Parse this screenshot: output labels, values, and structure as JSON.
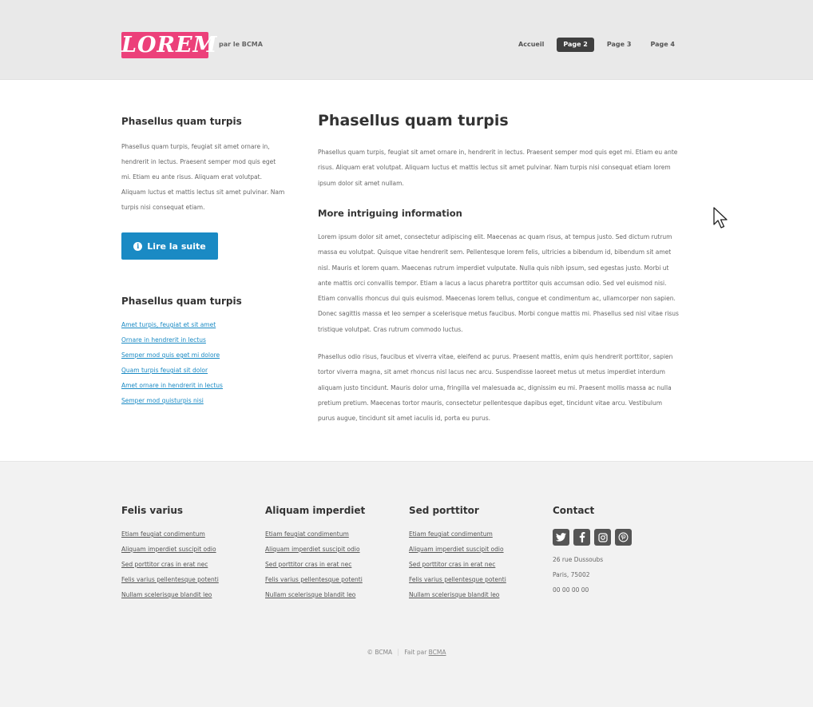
{
  "header": {
    "logo": "LOREM",
    "tagline": "par le BCMA",
    "nav": [
      "Accueil",
      "Page 2",
      "Page 3",
      "Page 4"
    ]
  },
  "sidebar": {
    "title1": "Phasellus quam turpis",
    "text": "Phasellus quam turpis, feugiat sit amet ornare in, hendrerit in lectus. Praesent semper mod quis eget mi. Etiam eu ante risus. Aliquam erat volutpat. Aliquam luctus et mattis lectus sit amet pulvinar. Nam turpis nisi consequat etiam.",
    "button_label": "Lire la suite",
    "title2": "Phasellus quam turpis",
    "links": [
      "Amet turpis, feugiat et sit amet",
      "Ornare in hendrerit in lectus",
      "Semper mod quis eget mi dolore",
      "Quam turpis feugiat sit dolor",
      "Amet ornare in hendrerit in lectus",
      "Semper mod quisturpis nisi"
    ]
  },
  "content": {
    "title": "Phasellus quam turpis",
    "intro": "Phasellus quam turpis, feugiat sit amet ornare in, hendrerit in lectus. Praesent semper mod quis eget mi. Etiam eu ante risus. Aliquam erat volutpat. Aliquam luctus et mattis lectus sit amet pulvinar. Nam turpis nisi consequat etiam lorem ipsum dolor sit amet nullam.",
    "subtitle": "More intriguing information",
    "para1": "Lorem ipsum dolor sit amet, consectetur adipiscing elit. Maecenas ac quam risus, at tempus justo. Sed dictum rutrum massa eu volutpat. Quisque vitae hendrerit sem. Pellentesque lorem felis, ultricies a bibendum id, bibendum sit amet nisl. Mauris et lorem quam. Maecenas rutrum imperdiet vulputate. Nulla quis nibh ipsum, sed egestas justo. Morbi ut ante mattis orci convallis tempor. Etiam a lacus a lacus pharetra porttitor quis accumsan odio. Sed vel euismod nisi. Etiam convallis rhoncus dui quis euismod. Maecenas lorem tellus, congue et condimentum ac, ullamcorper non sapien. Donec sagittis massa et leo semper a scelerisque metus faucibus. Morbi congue mattis mi. Phasellus sed nisl vitae risus tristique volutpat. Cras rutrum commodo luctus.",
    "para2": "Phasellus odio risus, faucibus et viverra vitae, eleifend ac purus. Praesent mattis, enim quis hendrerit porttitor, sapien tortor viverra magna, sit amet rhoncus nisl lacus nec arcu. Suspendisse laoreet metus ut metus imperdiet interdum aliquam justo tincidunt. Mauris dolor urna, fringilla vel malesuada ac, dignissim eu mi. Praesent mollis massa ac nulla pretium pretium. Maecenas tortor mauris, consectetur pellentesque dapibus eget, tincidunt vitae arcu. Vestibulum purus augue, tincidunt sit amet iaculis id, porta eu purus."
  },
  "footer": {
    "columns": [
      {
        "title": "Felis varius",
        "links": [
          "Etiam feugiat condimentum",
          "Aliquam imperdiet suscipit odio",
          "Sed porttitor cras in erat nec",
          "Felis varius pellentesque potenti",
          "Nullam scelerisque blandit leo"
        ]
      },
      {
        "title": "Aliquam imperdiet",
        "links": [
          "Etiam feugiat condimentum",
          "Aliquam imperdiet suscipit odio",
          "Sed porttitor cras in erat nec",
          "Felis varius pellentesque potenti",
          "Nullam scelerisque blandit leo"
        ]
      },
      {
        "title": "Sed porttitor",
        "links": [
          "Etiam feugiat condimentum",
          "Aliquam imperdiet suscipit odio",
          "Sed porttitor cras in erat nec",
          "Felis varius pellentesque potenti",
          "Nullam scelerisque blandit leo"
        ]
      }
    ],
    "contact": {
      "title": "Contact",
      "socials": [
        "twitter-icon",
        "facebook-icon",
        "instagram-icon",
        "pinterest-icon"
      ],
      "address": [
        "26 rue Dussoubs",
        "Paris, 75002",
        "00 00 00 00"
      ]
    },
    "copyright": "© BCMA",
    "made_by_prefix": "Fait par",
    "made_by_link": "BCMA"
  },
  "colors": {
    "logo_bg": "#ec407a",
    "button_bg": "#1a8ac4",
    "nav_active_bg": "#3f3f3f"
  }
}
